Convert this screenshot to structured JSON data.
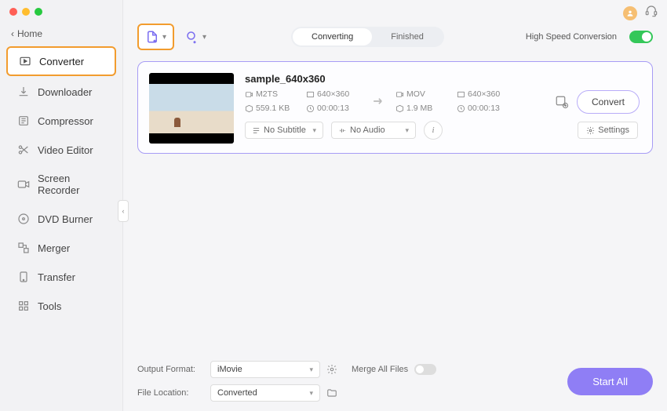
{
  "home_crumb": "Home",
  "sidebar": {
    "items": [
      {
        "label": "Converter"
      },
      {
        "label": "Downloader"
      },
      {
        "label": "Compressor"
      },
      {
        "label": "Video Editor"
      },
      {
        "label": "Screen Recorder"
      },
      {
        "label": "DVD Burner"
      },
      {
        "label": "Merger"
      },
      {
        "label": "Transfer"
      },
      {
        "label": "Tools"
      }
    ]
  },
  "tabs": {
    "converting": "Converting",
    "finished": "Finished"
  },
  "high_speed_label": "High Speed Conversion",
  "file": {
    "name": "sample_640x360",
    "src_format": "M2TS",
    "src_res": "640×360",
    "src_size": "559.1 KB",
    "src_dur": "00:00:13",
    "dst_format": "MOV",
    "dst_res": "640×360",
    "dst_size": "1.9 MB",
    "dst_dur": "00:00:13",
    "subtitle": "No Subtitle",
    "audio": "No Audio"
  },
  "settings_label": "Settings",
  "convert_label": "Convert",
  "footer": {
    "output_format_label": "Output Format:",
    "output_format_value": "iMovie",
    "file_location_label": "File Location:",
    "file_location_value": "Converted",
    "merge_label": "Merge All Files",
    "start_all": "Start All"
  }
}
